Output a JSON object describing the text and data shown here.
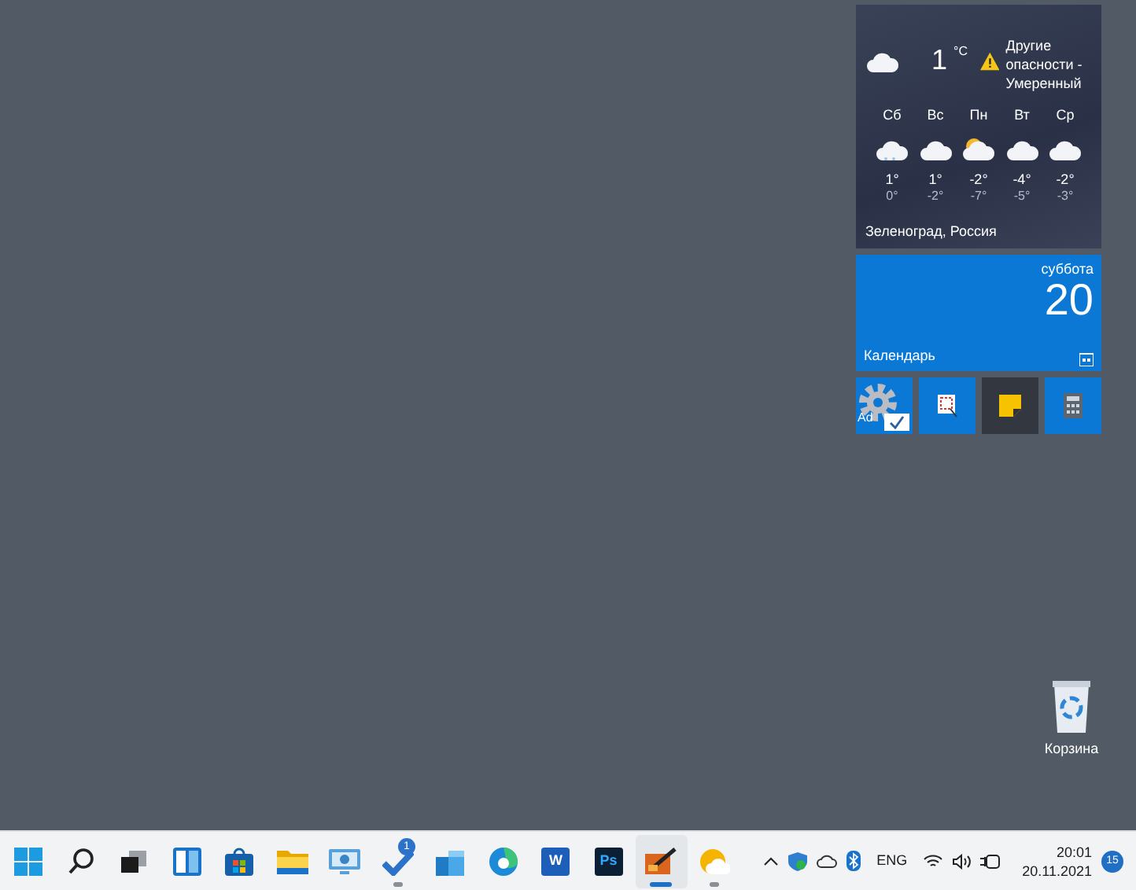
{
  "weather": {
    "kind": "cloudy",
    "temperature": "1",
    "unit": "°C",
    "alert": "Другие опасности - Умеренный",
    "forecast": [
      {
        "day": "Сб",
        "kind": "snow",
        "high": "1°",
        "low": "0°"
      },
      {
        "day": "Вс",
        "kind": "cloudy",
        "high": "1°",
        "low": "-2°"
      },
      {
        "day": "Пн",
        "kind": "partly-sunny",
        "high": "-2°",
        "low": "-7°"
      },
      {
        "day": "Вт",
        "kind": "cloudy",
        "high": "-4°",
        "low": "-5°"
      },
      {
        "day": "Ср",
        "kind": "cloudy",
        "high": "-2°",
        "low": "-3°"
      }
    ],
    "location": "Зеленоград, Россия"
  },
  "calendar": {
    "weekday": "суббота",
    "day": "20",
    "label": "Календарь"
  },
  "small_tiles": [
    {
      "kind": "settings",
      "label": "Ad"
    },
    {
      "kind": "snip"
    },
    {
      "kind": "sticky"
    },
    {
      "kind": "calculator"
    }
  ],
  "desktop_icons": [
    {
      "kind": "recycle-bin",
      "label": "Корзина"
    }
  ],
  "taskbar": {
    "apps": [
      {
        "kind": "start",
        "running": false,
        "active": false
      },
      {
        "kind": "search",
        "running": false,
        "active": false
      },
      {
        "kind": "task-view",
        "running": false,
        "active": false
      },
      {
        "kind": "widgets",
        "running": false,
        "active": false
      },
      {
        "kind": "store",
        "running": false,
        "active": false
      },
      {
        "kind": "explorer",
        "running": false,
        "active": false
      },
      {
        "kind": "remote",
        "running": false,
        "active": false
      },
      {
        "kind": "tasks",
        "badge": "1",
        "running": true,
        "active": false
      },
      {
        "kind": "package",
        "running": false,
        "active": false
      },
      {
        "kind": "edge",
        "running": false,
        "active": false
      },
      {
        "kind": "word",
        "label": "W",
        "running": false,
        "active": false
      },
      {
        "kind": "photoshop",
        "label": "Ps",
        "running": false,
        "active": false
      },
      {
        "kind": "paint",
        "running": true,
        "active": true
      },
      {
        "kind": "weather",
        "running": true,
        "active": false
      }
    ],
    "tray": {
      "language": "ENG",
      "time": "20:01",
      "date": "20.11.2021",
      "notifications": "15"
    }
  }
}
